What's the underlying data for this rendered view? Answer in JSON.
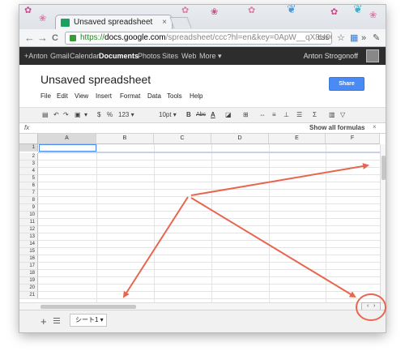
{
  "browser": {
    "tab_title": "Unsaved spreadsheet",
    "tab_close": "×",
    "url_scheme": "https://",
    "url_host": "docs.google.com",
    "url_rest": "/spreadsheet/ccc?hl=en&key=0ApW__qX8U063dD...",
    "url_suffix": "css",
    "back": "←",
    "forward": "→",
    "reload": "C"
  },
  "google_bar": {
    "items": [
      "+Anton",
      "Gmail",
      "Calendar",
      "Documents",
      "Photos",
      "Sites",
      "Web",
      "More ▾"
    ],
    "active": "Documents",
    "user": "Anton Strogonoff"
  },
  "doc": {
    "title": "Unsaved spreadsheet",
    "share_label": "Share",
    "menu": [
      "File",
      "Edit",
      "View",
      "Insert",
      "Format",
      "Data",
      "Tools",
      "Help"
    ]
  },
  "format_toolbar": {
    "percent": "%",
    "number_format": "123 ▾",
    "font_size": "10pt ▾",
    "bold": "B",
    "strike": "Abc",
    "text_color": "A",
    "sum": "Σ"
  },
  "formula_bar": {
    "fx": "fx",
    "show_formulas": "Show all formulas",
    "close": "×"
  },
  "grid": {
    "columns": [
      "A",
      "B",
      "C",
      "D",
      "E",
      "F"
    ],
    "rows": [
      "1",
      "2",
      "3",
      "4",
      "5",
      "6",
      "7",
      "8",
      "9",
      "10",
      "11",
      "12",
      "13",
      "14",
      "15",
      "16",
      "17",
      "18",
      "19",
      "20",
      "21"
    ],
    "selected_cell": "A1"
  },
  "sheets": {
    "add": "+",
    "tab_label": "シート1 ▾"
  },
  "sheet_nav": {
    "prev": "‹",
    "next": "›"
  },
  "colors": {
    "annotation": "#e8664f",
    "share_button": "#4a8af4",
    "selection": "#4a8af4"
  }
}
